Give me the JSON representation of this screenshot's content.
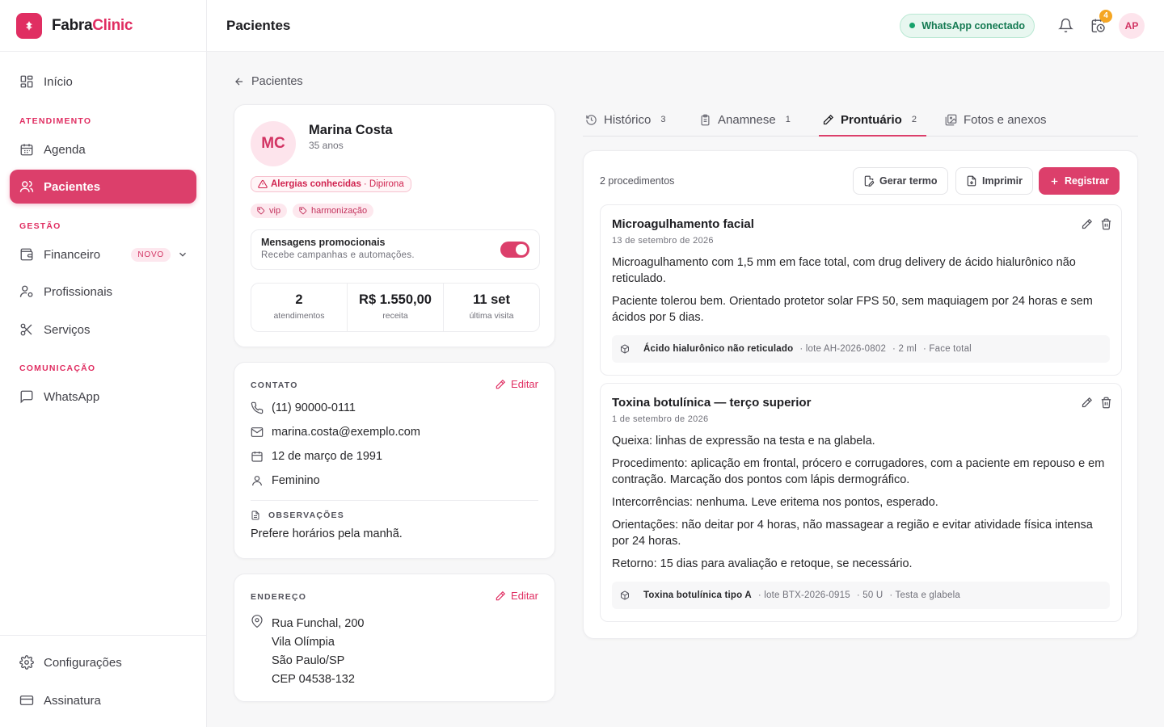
{
  "brand": {
    "name_a": "Fabra",
    "name_b": "Clinic"
  },
  "sidebar": {
    "home": "Início",
    "section_atendimento": "ATENDIMENTO",
    "agenda": "Agenda",
    "pacientes": "Pacientes",
    "section_gestao": "GESTÃO",
    "financeiro": "Financeiro",
    "financeiro_badge": "NOVO",
    "profissionais": "Profissionais",
    "servicos": "Serviços",
    "section_comunicacao": "COMUNICAÇÃO",
    "whatsapp": "WhatsApp",
    "configuracoes": "Configurações",
    "assinatura": "Assinatura"
  },
  "topbar": {
    "title": "Pacientes",
    "whatsapp_status": "WhatsApp conectado",
    "notif_count": "4",
    "user_initials": "AP"
  },
  "back_link": "Pacientes",
  "patient": {
    "initials": "MC",
    "name": "Marina Costa",
    "age": "35 anos",
    "allergy_label": "Alergias conhecidas",
    "allergy_value": "· Dipirona",
    "tags": [
      "vip",
      "harmonização"
    ],
    "promo_title": "Mensagens promocionais",
    "promo_sub": "Recebe campanhas e automações.",
    "promo_enabled": true,
    "stats": [
      {
        "value": "2",
        "label": "atendimentos"
      },
      {
        "value": "R$ 1.550,00",
        "label": "receita"
      },
      {
        "value": "11 set",
        "label": "última visita"
      }
    ]
  },
  "contact": {
    "label": "CONTATO",
    "edit": "Editar",
    "phone": "(11) 90000-0111",
    "email": "marina.costa@exemplo.com",
    "birth": "12 de março de 1991",
    "gender": "Feminino",
    "obs_label": "OBSERVAÇÕES",
    "obs": "Prefere horários pela manhã."
  },
  "address": {
    "label": "ENDEREÇO",
    "edit": "Editar",
    "street": "Rua Funchal, 200",
    "district": "Vila Olímpia",
    "city": "São Paulo/SP",
    "zip": "CEP 04538-132"
  },
  "tabs": [
    {
      "label": "Histórico",
      "count": "3"
    },
    {
      "label": "Anamnese",
      "count": "1"
    },
    {
      "label": "Prontuário",
      "count": "2"
    },
    {
      "label": "Fotos e anexos",
      "count": ""
    }
  ],
  "records": {
    "count_text": "2 procedimentos",
    "btn_termo": "Gerar termo",
    "btn_imprimir": "Imprimir",
    "btn_registrar": "Registrar",
    "entries": [
      {
        "title": "Microagulhamento facial",
        "date": "13 de setembro de 2026",
        "paragraphs": [
          "Microagulhamento com 1,5 mm em face total, com drug delivery de ácido hialurônico não reticulado.",
          "Paciente tolerou bem. Orientado protetor solar FPS 50, sem maquiagem por 24 horas e sem ácidos por 5 dias."
        ],
        "product": "Ácido hialurônico não reticulado",
        "lot": "· lote AH-2026-0802",
        "qty": "· 2 ml",
        "area": "· Face total"
      },
      {
        "title": "Toxina botulínica — terço superior",
        "date": "1 de setembro de 2026",
        "paragraphs": [
          "Queixa: linhas de expressão na testa e na glabela.",
          "Procedimento: aplicação em frontal, prócero e corrugadores, com a paciente em repouso e em contração. Marcação dos pontos com lápis dermográfico.",
          "Intercorrências: nenhuma. Leve eritema nos pontos, esperado.",
          "Orientações: não deitar por 4 horas, não massagear a região e evitar atividade física intensa por 24 horas.",
          "Retorno: 15 dias para avaliação e retoque, se necessário."
        ],
        "product": "Toxina botulínica tipo A",
        "lot": "· lote BTX-2026-0915",
        "qty": "· 50 U",
        "area": "· Testa e glabela"
      }
    ]
  },
  "colors": {
    "accent": "#dc3f6b",
    "brand": "#e02e62",
    "success": "#17a26b",
    "warning": "#f5a623"
  }
}
